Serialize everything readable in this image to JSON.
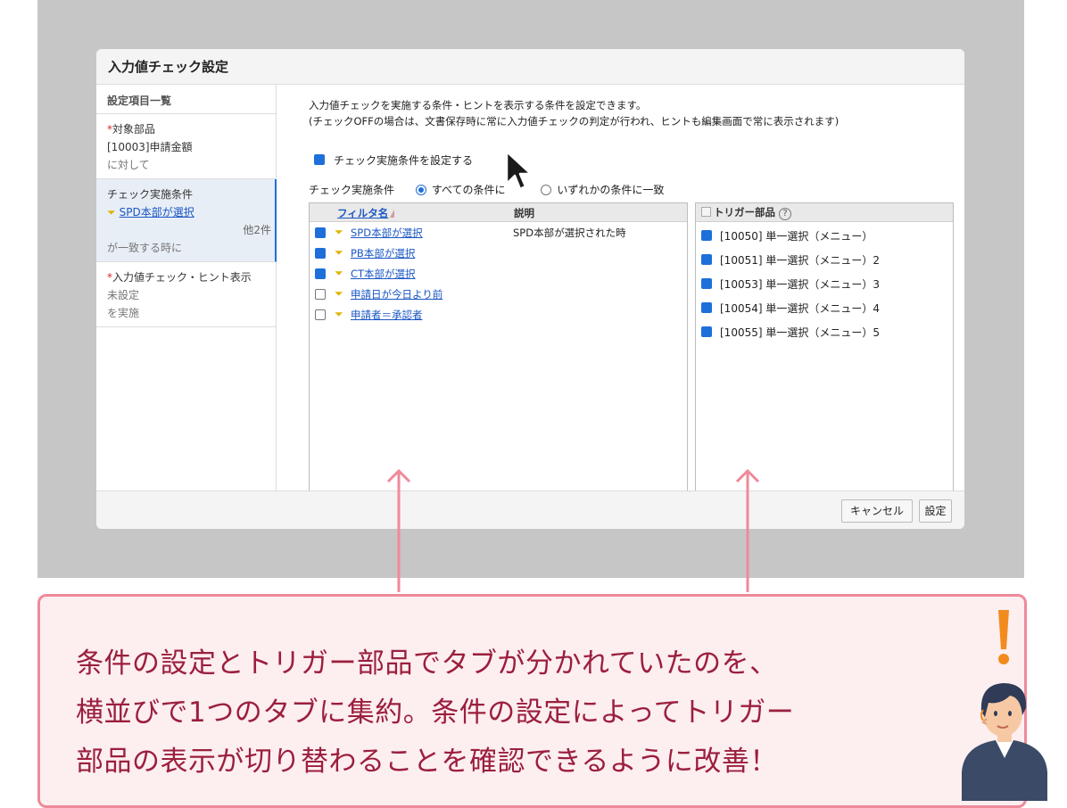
{
  "dialog": {
    "title": "入力値チェック設定",
    "cancel_label": "キャンセル",
    "ok_label": "設定"
  },
  "nav": {
    "header": "設定項目一覧",
    "sections": [
      {
        "required": "*",
        "title": "対象部品",
        "value": "[10003]申請金額",
        "note": "に対して"
      },
      {
        "title": "チェック実施条件",
        "link": "SPD本部が選択",
        "more": "他2件",
        "note": "が一致する時に"
      },
      {
        "required": "*",
        "title": "入力値チェック・ヒント表示",
        "value": "未設定",
        "note": "を実施"
      }
    ]
  },
  "main": {
    "desc_line1": "入力値チェックを実施する条件・ヒントを表示する条件を設定できます。",
    "desc_line2": "(チェックOFFの場合は、文書保存時に常に入力値チェックの判定が行われ、ヒントも編集画面で常に表示されます)",
    "enable_check_label": "チェック実施条件を設定する",
    "condition_label": "チェック実施条件",
    "radio_all": "すべての条件に",
    "radio_any": "いずれかの条件に一致"
  },
  "filter_table": {
    "col_name": "フィルタ名",
    "col_desc": "説明",
    "rows": [
      {
        "checked": true,
        "name": "SPD本部が選択",
        "desc": "SPD本部が選択された時"
      },
      {
        "checked": true,
        "name": "PB本部が選択",
        "desc": ""
      },
      {
        "checked": true,
        "name": "CT本部が選択",
        "desc": ""
      },
      {
        "checked": false,
        "name": "申請日が今日より前",
        "desc": ""
      },
      {
        "checked": false,
        "name": "申請者＝承認者",
        "desc": ""
      }
    ]
  },
  "trigger_table": {
    "header": "トリガー部品",
    "help": "?",
    "rows": [
      {
        "checked": true,
        "name": "[10050] 単一選択（メニュー）"
      },
      {
        "checked": true,
        "name": "[10051] 単一選択（メニュー）2"
      },
      {
        "checked": true,
        "name": "[10053] 単一選択（メニュー）3"
      },
      {
        "checked": true,
        "name": "[10054] 単一選択（メニュー）4"
      },
      {
        "checked": true,
        "name": "[10055] 単一選択（メニュー）5"
      }
    ]
  },
  "callout": {
    "line1": "条件の設定とトリガー部品でタブが分かれていたのを、",
    "line2": "横並びで1つのタブに集約。条件の設定によってトリガー",
    "line3": "部品の表示が切り替わることを確認できるように改善！"
  },
  "colors": {
    "accent": "#1e6fd9",
    "callout_border": "#ee8a9a",
    "callout_bg": "#fdeef0",
    "callout_text": "#9b1f3d",
    "exclaim": "#f28b1e"
  }
}
